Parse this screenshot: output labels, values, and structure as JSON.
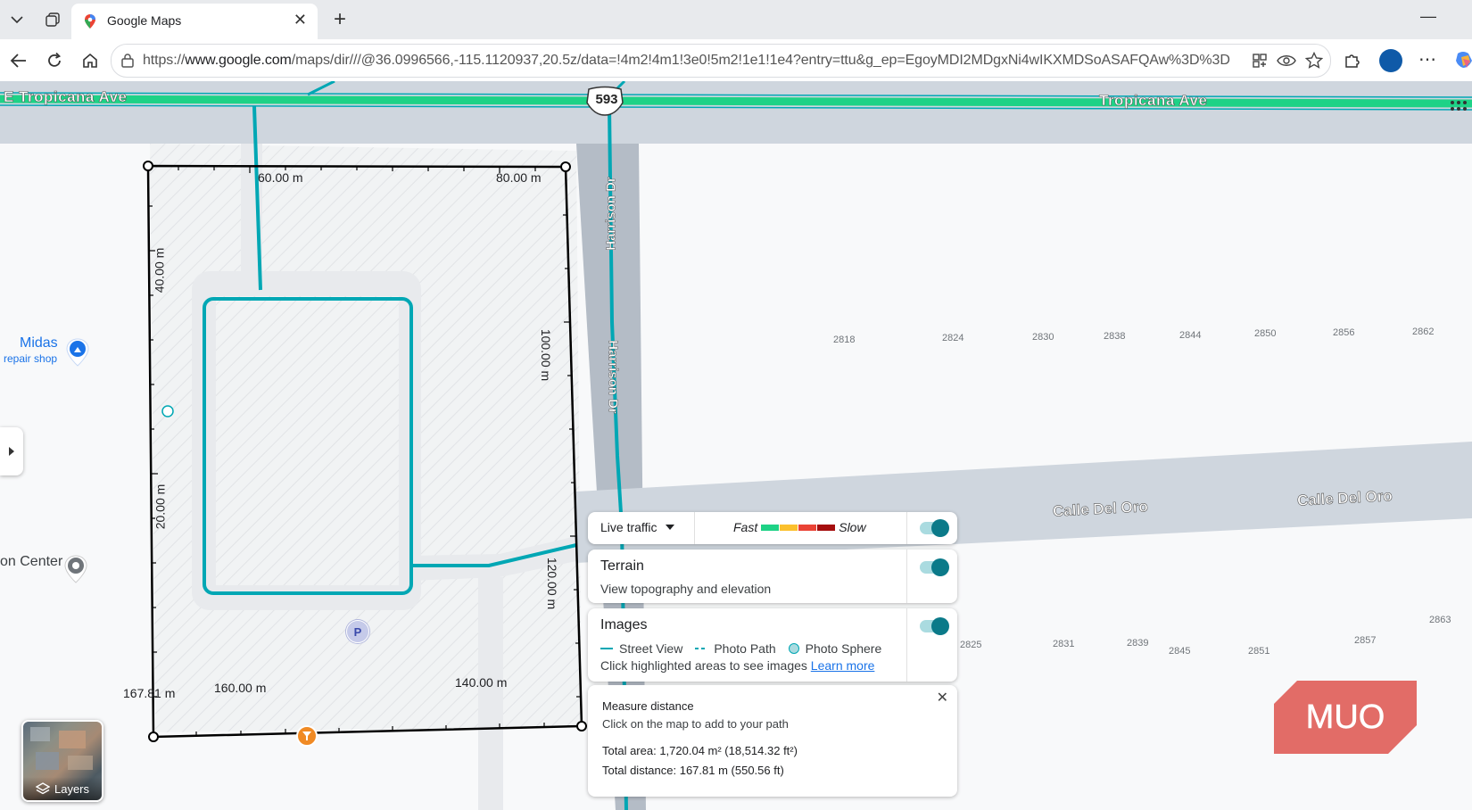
{
  "browser": {
    "tab_title": "Google Maps",
    "url_prefix": "https://",
    "url_host": "www.google.com",
    "url_path": "/maps/dir///@36.0996566,-115.1120937,20.5z/data=!4m2!4m1!3e0!5m2!1e1!1e4?entry=ttu&g_ep=EgoyMDI2MDgxNi4wIKXMDSoASAFQAw%3D%3D"
  },
  "map": {
    "roads": {
      "tropicana_left": "E Tropicana Ave",
      "tropicana_right": "Tropicana Ave",
      "route_shield": "593",
      "harrison_top": "Harrison Dr",
      "harrison_mid": "Harrison Dr",
      "calle_1": "Calle Del Oro",
      "calle_2": "Calle Del Oro"
    },
    "pois": {
      "midas_name": "Midas",
      "midas_type": "repair shop",
      "center_name": "on Center",
      "parking_label": "P"
    },
    "measure_labels": [
      "60.00 m",
      "80.00 m",
      "40.00 m",
      "100.00 m",
      "20.00 m",
      "120.00 m",
      "160.00 m",
      "140.00 m",
      "167.81 m"
    ],
    "addresses_top": [
      "2818",
      "2824",
      "2830",
      "2838",
      "2844",
      "2850",
      "2856",
      "2862"
    ],
    "addresses_bottom": [
      "2825",
      "2831",
      "2839",
      "2845",
      "2851",
      "2857",
      "2863"
    ]
  },
  "layer_panels": {
    "traffic": {
      "label": "Live traffic",
      "fast": "Fast",
      "slow": "Slow",
      "colors": [
        "#1ed286",
        "#fbc02d",
        "#ea4335",
        "#a50e0e"
      ]
    },
    "terrain": {
      "title": "Terrain",
      "subtitle": "View topography and elevation"
    },
    "images": {
      "title": "Images",
      "street_view": "Street View",
      "photo_path": "Photo Path",
      "photo_sphere": "Photo Sphere",
      "hint": "Click highlighted areas to see images",
      "learn_more": "Learn more"
    }
  },
  "measure": {
    "title": "Measure distance",
    "subtitle": "Click on the map to add to your path",
    "total_area": "Total area: 1,720.04 m² (18,514.32 ft²)",
    "total_distance": "Total distance: 167.81 m (550.56 ft)"
  },
  "layers_button": {
    "label": "Layers"
  },
  "watermark": {
    "text": "MUO",
    "color": "#e0645f"
  }
}
